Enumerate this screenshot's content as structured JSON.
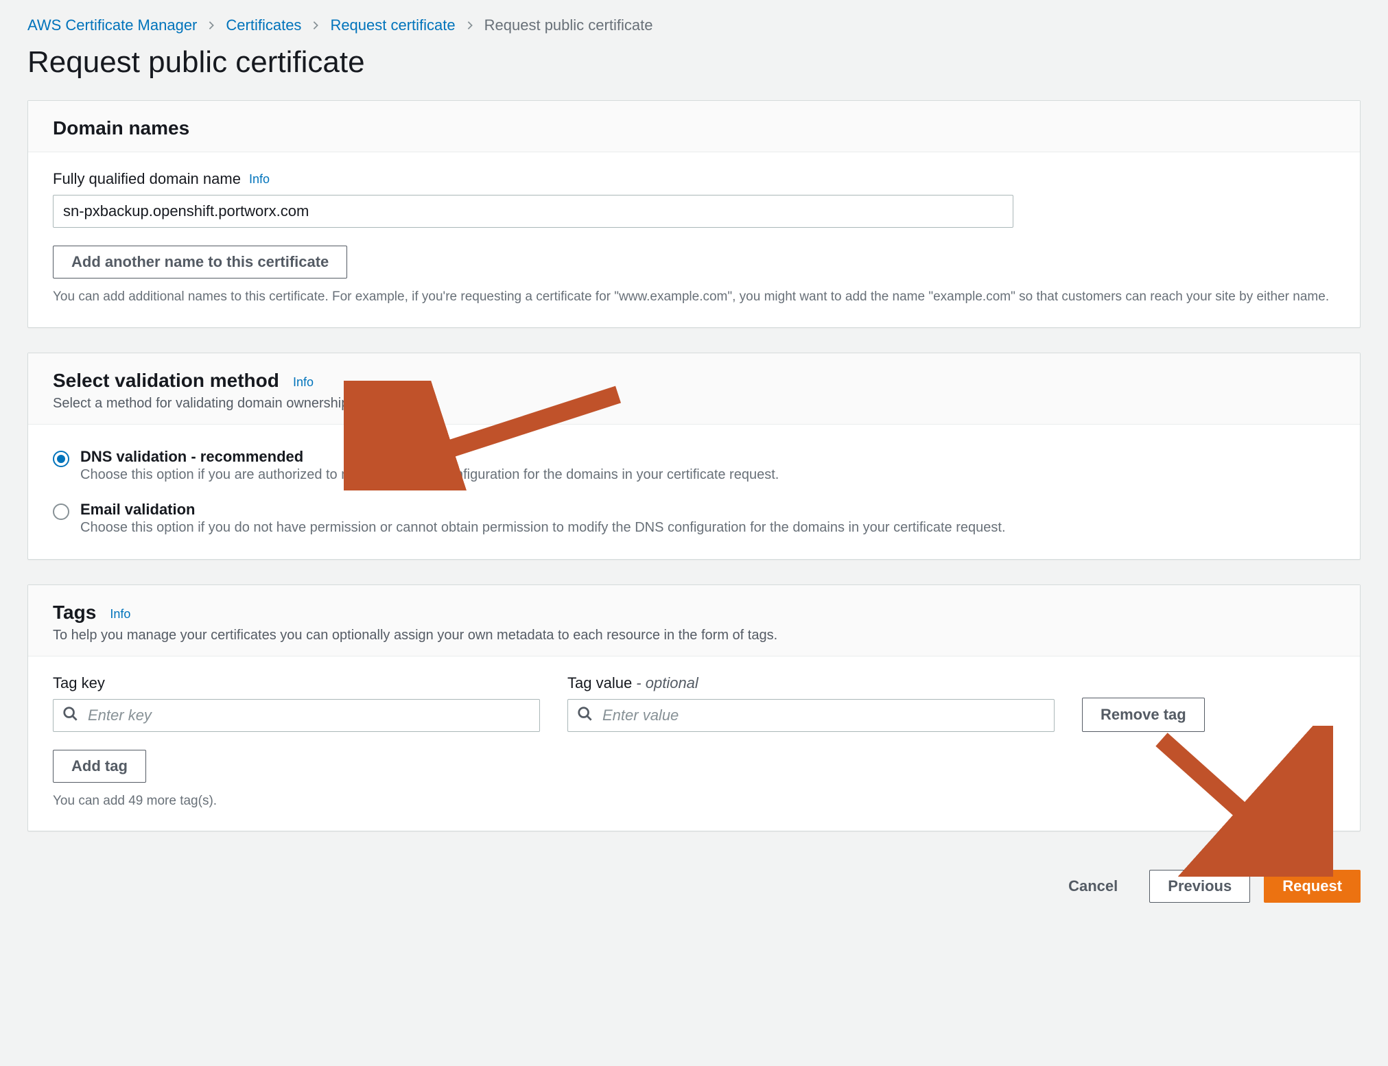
{
  "breadcrumb": {
    "items": [
      "AWS Certificate Manager",
      "Certificates",
      "Request certificate"
    ],
    "current": "Request public certificate"
  },
  "page_title": "Request public certificate",
  "info_label": "Info",
  "domain_panel": {
    "title": "Domain names",
    "field_label": "Fully qualified domain name",
    "input_value": "sn-pxbackup.openshift.portworx.com",
    "add_button": "Add another name to this certificate",
    "help": "You can add additional names to this certificate. For example, if you're requesting a certificate for \"www.example.com\", you might want to add the name \"example.com\" so that customers can reach your site by either name."
  },
  "validation_panel": {
    "title": "Select validation method",
    "subtitle": "Select a method for validating domain ownership",
    "options": [
      {
        "label": "DNS validation - recommended",
        "desc": "Choose this option if you are authorized to modify the DNS configuration for the domains in your certificate request.",
        "selected": true
      },
      {
        "label": "Email validation",
        "desc": "Choose this option if you do not have permission or cannot obtain permission to modify the DNS configuration for the domains in your certificate request.",
        "selected": false
      }
    ]
  },
  "tags_panel": {
    "title": "Tags",
    "subtitle": "To help you manage your certificates you can optionally assign your own metadata to each resource in the form of tags.",
    "key_label": "Tag key",
    "value_label": "Tag value",
    "value_optional": " - optional",
    "key_placeholder": "Enter key",
    "value_placeholder": "Enter value",
    "remove_button": "Remove tag",
    "add_button": "Add tag",
    "limit_text": "You can add 49 more tag(s)."
  },
  "actions": {
    "cancel": "Cancel",
    "previous": "Previous",
    "request": "Request"
  },
  "colors": {
    "accent_orange": "#ec7211",
    "link_blue": "#0073bb",
    "arrow": "#c0522a"
  }
}
